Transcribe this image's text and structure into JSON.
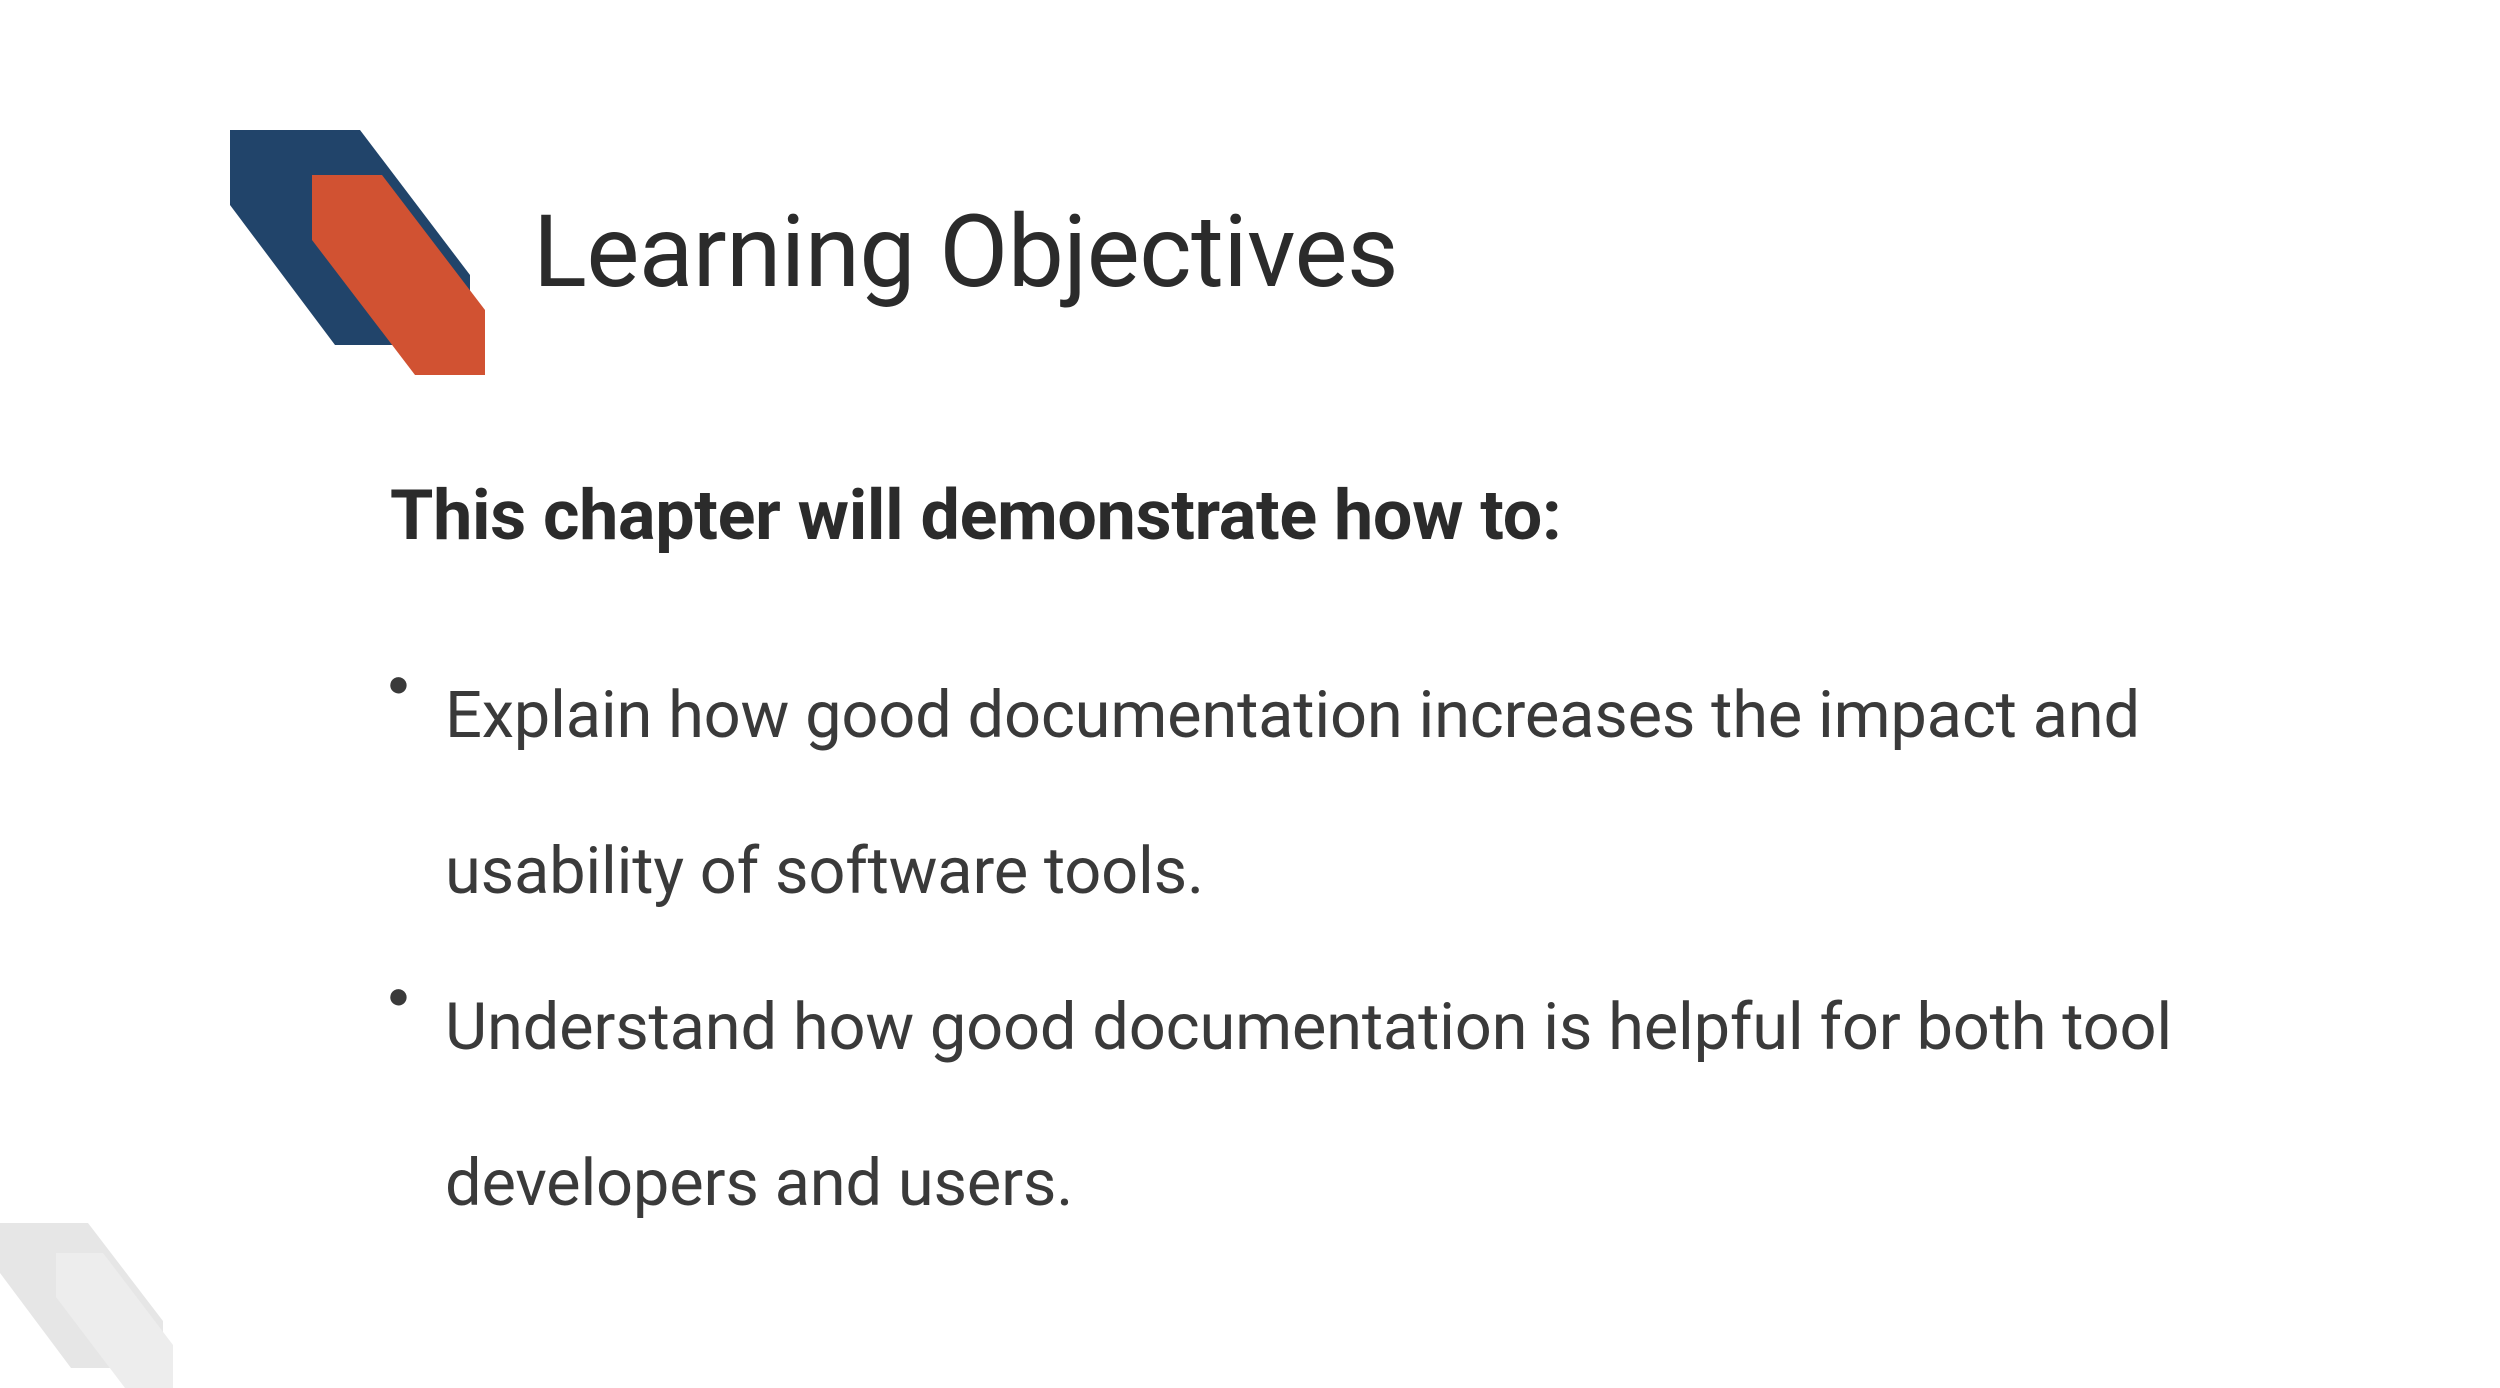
{
  "slide": {
    "title": "Learning Objectives",
    "subtitle": "This chapter will demonstrate how to:",
    "bullets": [
      "Explain how good documentation increases the impact and usability of software tools.",
      "Understand how good documentation is helpful for both tool developers and users."
    ],
    "colors": {
      "navy": "#21446a",
      "orange": "#d15232",
      "light_gray": "#e6e6e6",
      "text": "#2b2b2b"
    }
  }
}
